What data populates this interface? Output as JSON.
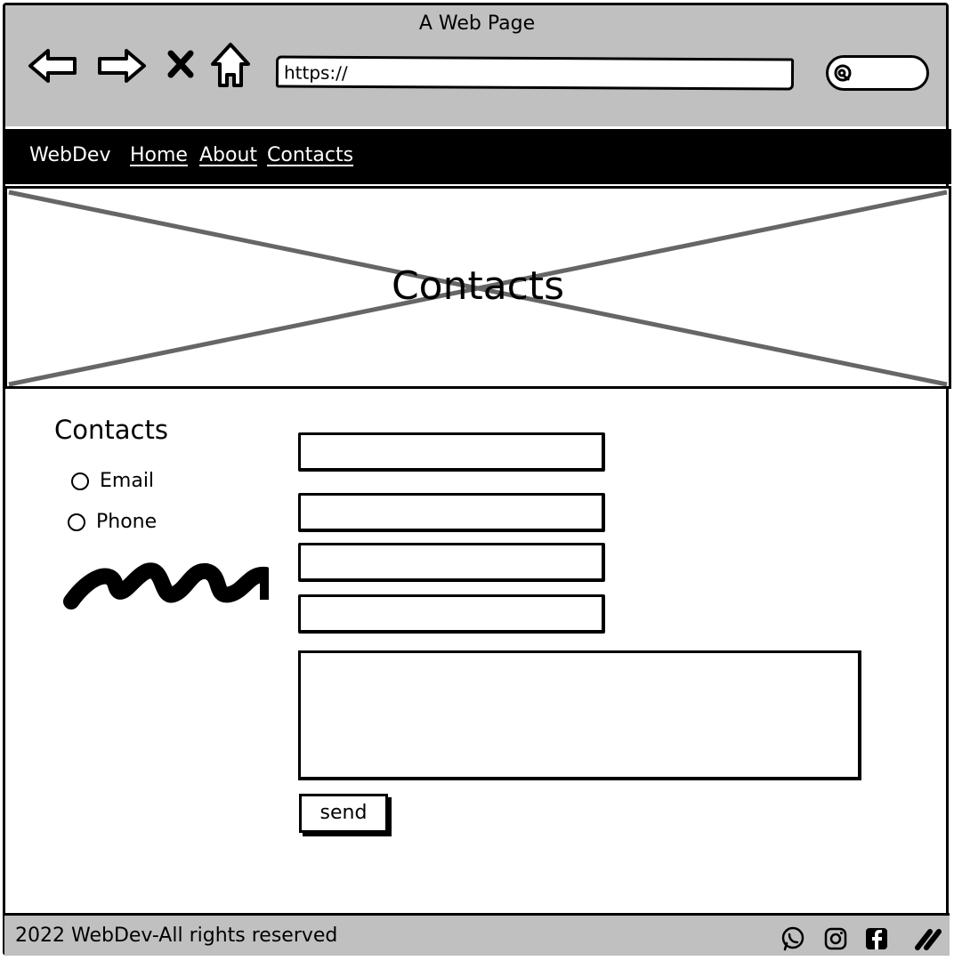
{
  "browser": {
    "title": "A Web Page",
    "url": "https://",
    "icons": [
      "back-icon",
      "forward-icon",
      "close-icon",
      "home-icon",
      "search-icon"
    ]
  },
  "navbar": {
    "brand": "WebDev",
    "links": [
      "Home",
      "About",
      "Contacts"
    ]
  },
  "hero": {
    "title": "Contacts"
  },
  "contact": {
    "title": "Contacts",
    "options": [
      "Email",
      "Phone"
    ],
    "send_label": "send"
  },
  "footer": {
    "text": "2022 WebDev-All rights reserved",
    "social_icons": [
      "whatsapp-icon",
      "instagram-icon",
      "facebook-icon",
      "link-icon"
    ]
  },
  "colors": {
    "chrome": "#c0c0c0",
    "navbar": "#000000",
    "hero_cross": "#666666"
  }
}
